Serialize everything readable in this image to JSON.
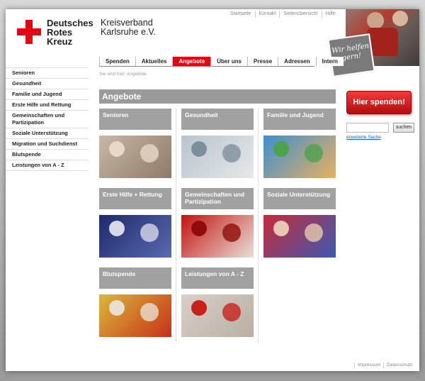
{
  "top_links": [
    "Startseite",
    "Kontakt",
    "Seitenübersicht",
    "Hilfe"
  ],
  "logo": {
    "line1": "Deutsches",
    "line2": "Rotes",
    "line3": "Kreuz"
  },
  "org": {
    "line1": "Kreisverband",
    "line2": "Karlsruhe e.V."
  },
  "badge": {
    "line1": "Wir helfen",
    "line2": "gern!"
  },
  "nav": [
    "Spenden",
    "Aktuelles",
    "Angebote",
    "Über uns",
    "Presse",
    "Adressen",
    "Intern"
  ],
  "nav_active": "Angebote",
  "sidebar": [
    "Senioren",
    "Gesundheit",
    "Familie und Jugend",
    "Erste Hilfe und Rettung",
    "Gemeinschaften und Partizipation",
    "Soziale Unterstützung",
    "Migration und Suchdienst",
    "Blutspende",
    "Leistungen von A - Z"
  ],
  "breadcrumb": "Sie sind hier: Angebote",
  "content_title": "Angebote",
  "tiles": [
    {
      "label": "Senioren",
      "colors": [
        "#c8b8a4",
        "#8e7a6a",
        "#e8d8c8"
      ]
    },
    {
      "label": "Gesundheit",
      "colors": [
        "#b8c4cc",
        "#e6e8ea",
        "#7d8f9a"
      ]
    },
    {
      "label": "Familie und Jugend",
      "colors": [
        "#3d8fcf",
        "#e8b060",
        "#4ca24a"
      ]
    },
    {
      "label": "Erste Hilfe + Rettung",
      "colors": [
        "#1d2a6b",
        "#5a6ab0",
        "#d8d8e8"
      ]
    },
    {
      "label": "Gemeinschaften und Partizipation",
      "colors": [
        "#c2130f",
        "#e8e0d8",
        "#8e0c0a"
      ]
    },
    {
      "label": "Soziale Unterstützung",
      "colors": [
        "#c82a3a",
        "#3a5ab0",
        "#e8c8b0"
      ]
    },
    {
      "label": "Blutspende",
      "colors": [
        "#d9b83a",
        "#c8301a",
        "#e8e0d0"
      ]
    },
    {
      "label": "Leistungen von A - Z",
      "colors": [
        "#d8d0c8",
        "#b8aea4",
        "#c8201a"
      ]
    }
  ],
  "spenden_label": "Hier spenden!",
  "search": {
    "button": "suchen",
    "link": "erweiterte Suche",
    "placeholder": ""
  },
  "footer": [
    "Impressum",
    "Datenschutz"
  ],
  "colors": {
    "brand_red": "#e30613",
    "tile_gray": "#a1a1a1"
  }
}
